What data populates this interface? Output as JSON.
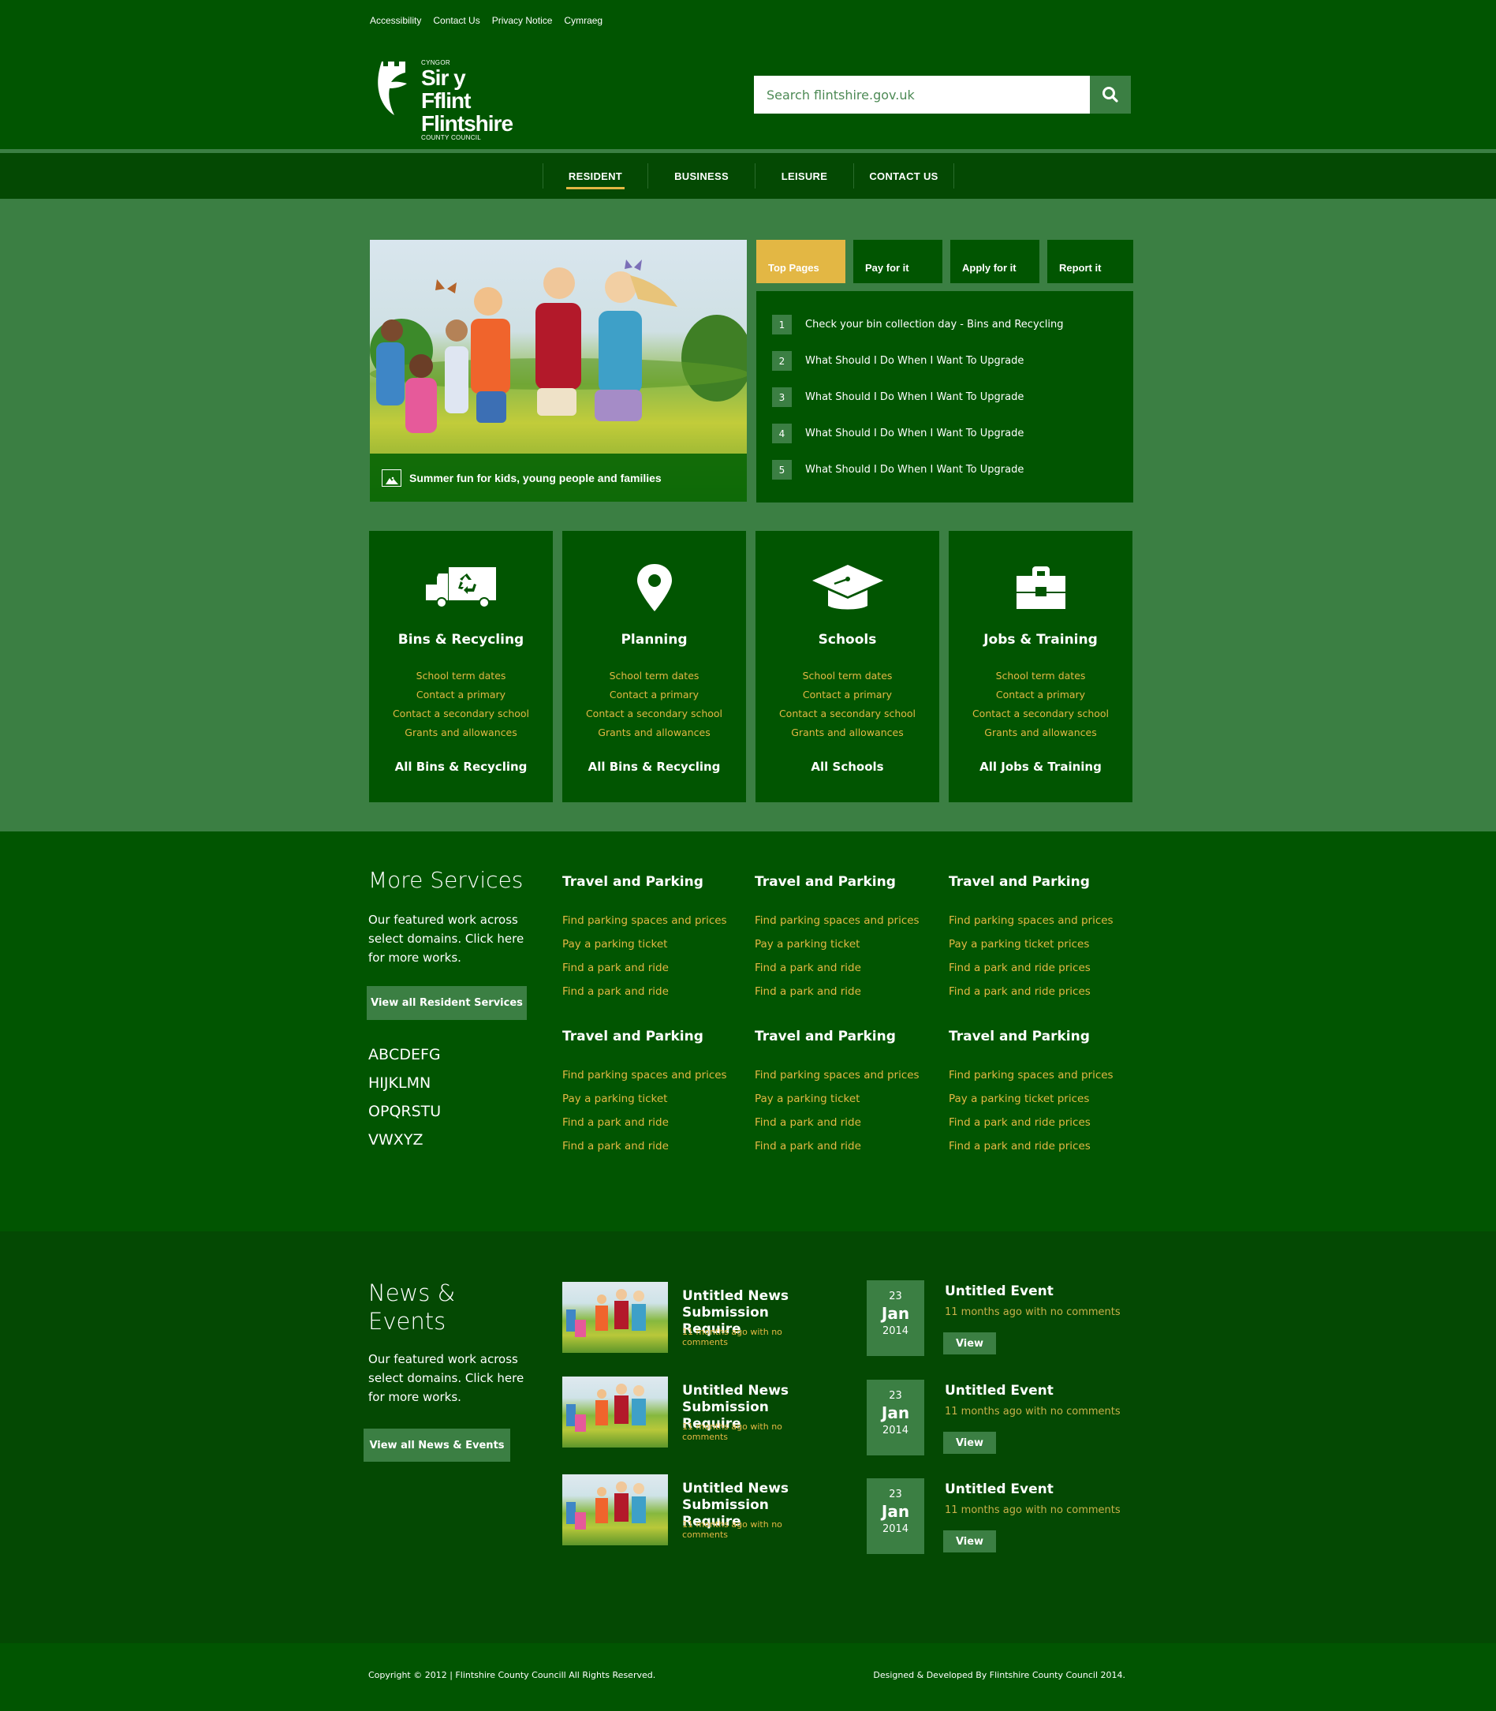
{
  "colors": {
    "header_bg": "#015501",
    "nav_bg": "#044903",
    "body_bg": "#3b7f43",
    "accent_gold": "#e3b744",
    "news_bg": "#044903"
  },
  "utility_links": [
    "Accessibility",
    "Contact Us",
    "Privacy Notice",
    "Cymraeg"
  ],
  "logo": {
    "line_small_top": "CYNGOR",
    "line1": "Sir y Fflint",
    "line2": "Flintshire",
    "line_small_bottom": "COUNTY COUNCIL"
  },
  "search": {
    "placeholder": "Search flintshire.gov.uk",
    "value": "",
    "button_icon": "search-icon"
  },
  "nav": {
    "items": [
      {
        "label": "RESIDENT",
        "active": true
      },
      {
        "label": "BUSINESS",
        "active": false
      },
      {
        "label": "LEISURE",
        "active": false
      },
      {
        "label": "CONTACT US",
        "active": false
      }
    ]
  },
  "hero": {
    "caption": "Summer fun for kids, young people and families",
    "caption_icon": "image-icon"
  },
  "quick_tabs": {
    "tabs": [
      {
        "label": "Top Pages",
        "active": true
      },
      {
        "label": "Pay for it",
        "active": false
      },
      {
        "label": "Apply for it",
        "active": false
      },
      {
        "label": "Report it",
        "active": false
      }
    ],
    "items": [
      {
        "num": "1",
        "text": "Check your bin collection day - Bins and Recycling"
      },
      {
        "num": "2",
        "text": "What Should I Do When I Want To Upgrade"
      },
      {
        "num": "3",
        "text": "What Should I Do When I Want To Upgrade"
      },
      {
        "num": "4",
        "text": "What Should I Do When I Want To Upgrade"
      },
      {
        "num": "5",
        "text": "What Should I Do When I Want To Upgrade"
      }
    ]
  },
  "service_cards": [
    {
      "icon": "recycling-truck-icon",
      "title": "Bins & Recycling",
      "links": [
        "School term dates",
        "Contact a primary",
        "Contact a secondary school",
        "Grants and allowances"
      ],
      "all_label": "All Bins & Recycling"
    },
    {
      "icon": "map-pin-icon",
      "title": "Planning",
      "links": [
        "School term dates",
        "Contact a primary",
        "Contact a secondary school",
        "Grants and allowances"
      ],
      "all_label": "All Bins & Recycling"
    },
    {
      "icon": "graduation-cap-icon",
      "title": "Schools",
      "links": [
        "School term dates",
        "Contact a primary",
        "Contact a secondary school",
        "Grants and allowances"
      ],
      "all_label": "All Schools"
    },
    {
      "icon": "briefcase-icon",
      "title": "Jobs & Training",
      "links": [
        "School term dates",
        "Contact a primary",
        "Contact a secondary school",
        "Grants and allowances"
      ],
      "all_label": "All Jobs & Training"
    }
  ],
  "more_services": {
    "title": "More Services",
    "description": "Our featured work across select domains. Click here for more works.",
    "button_label": "View all Resident Services",
    "alphabet_rows": [
      [
        "A",
        "B",
        "C",
        "D",
        "E",
        "F",
        "G"
      ],
      [
        "H",
        "I",
        "J",
        "K",
        "L",
        "M",
        "N"
      ],
      [
        "O",
        "P",
        "Q",
        "R",
        "S",
        "T",
        "U"
      ],
      [
        "V",
        "W",
        "X",
        "Y",
        "Z"
      ]
    ],
    "columns": [
      {
        "heading": "Travel and Parking",
        "links": [
          "Find parking spaces and prices",
          "Pay a parking ticket",
          "Find a park and ride",
          "Find a park and ride"
        ]
      },
      {
        "heading": "Travel and Parking",
        "links": [
          "Find parking spaces and prices",
          "Pay a parking ticket",
          "Find a park and ride",
          "Find a park and ride"
        ]
      },
      {
        "heading": "Travel and Parking",
        "links": [
          "Find parking spaces and prices",
          "Pay a parking ticket  prices",
          "Find a park and ride prices",
          "Find a park and ride prices"
        ]
      },
      {
        "heading": "Travel and Parking",
        "links": [
          "Find parking spaces and prices",
          "Pay a parking ticket",
          "Find a park and ride",
          "Find a park and ride"
        ]
      },
      {
        "heading": "Travel and Parking",
        "links": [
          "Find parking spaces and prices",
          "Pay a parking ticket",
          "Find a park and ride",
          "Find a park and ride"
        ]
      },
      {
        "heading": "Travel and Parking",
        "links": [
          "Find parking spaces and prices",
          "Pay a parking ticket prices",
          "Find a park and ride prices",
          "Find a park and ride prices"
        ]
      }
    ]
  },
  "news_events": {
    "title": "News & Events",
    "description": "Our featured work across select domains. Click here for more works.",
    "button_label": "View all News & Events",
    "news": [
      {
        "title": "Untitled News Submission Require",
        "meta": "11 months ago with no comments"
      },
      {
        "title": "Untitled News Submission Require",
        "meta": "11 months ago with no comments"
      },
      {
        "title": "Untitled News Submission Require",
        "meta": "11 months ago with no comments"
      }
    ],
    "events": [
      {
        "day": "23",
        "month": "Jan",
        "year": "2014",
        "title": "Untitled Event",
        "meta": "11 months ago with no comments",
        "button": "View"
      },
      {
        "day": "23",
        "month": "Jan",
        "year": "2014",
        "title": "Untitled Event",
        "meta": "11 months ago with no comments",
        "button": "View"
      },
      {
        "day": "23",
        "month": "Jan",
        "year": "2014",
        "title": "Untitled Event",
        "meta": "11 months ago with no comments",
        "button": "View"
      }
    ]
  },
  "footer": {
    "copyright": "Copyright © 2012 | Flintshire County Councill All Rights Reserved.",
    "credit": "Designed & Developed By Flintshire County Council 2014."
  }
}
